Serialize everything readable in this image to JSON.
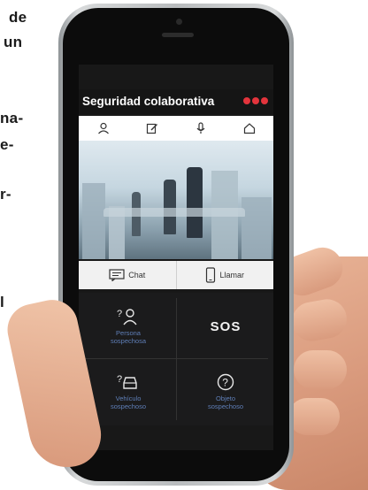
{
  "article_fragments": [
    "de",
    "un",
    "na-",
    "e-",
    "r-",
    "l"
  ],
  "app": {
    "title": "Seguridad colaborativa",
    "accent_color": "#e3343c",
    "tabs": [
      {
        "icon": "user-icon"
      },
      {
        "icon": "edit-icon"
      },
      {
        "icon": "microphone-icon"
      },
      {
        "icon": "home-icon"
      }
    ],
    "actions": [
      {
        "icon": "chat-icon",
        "label": "Chat"
      },
      {
        "icon": "phone-icon",
        "label": "Llamar"
      }
    ],
    "menu": [
      {
        "icon": "suspicious-person-icon",
        "line1": "Persona",
        "line2": "sospechosa"
      },
      {
        "label": "SOS"
      },
      {
        "icon": "suspicious-vehicle-icon",
        "line1": "Vehículo",
        "line2": "sospechoso"
      },
      {
        "icon": "question-icon",
        "line1": "Objeto",
        "line2": "sospechoso"
      }
    ]
  }
}
